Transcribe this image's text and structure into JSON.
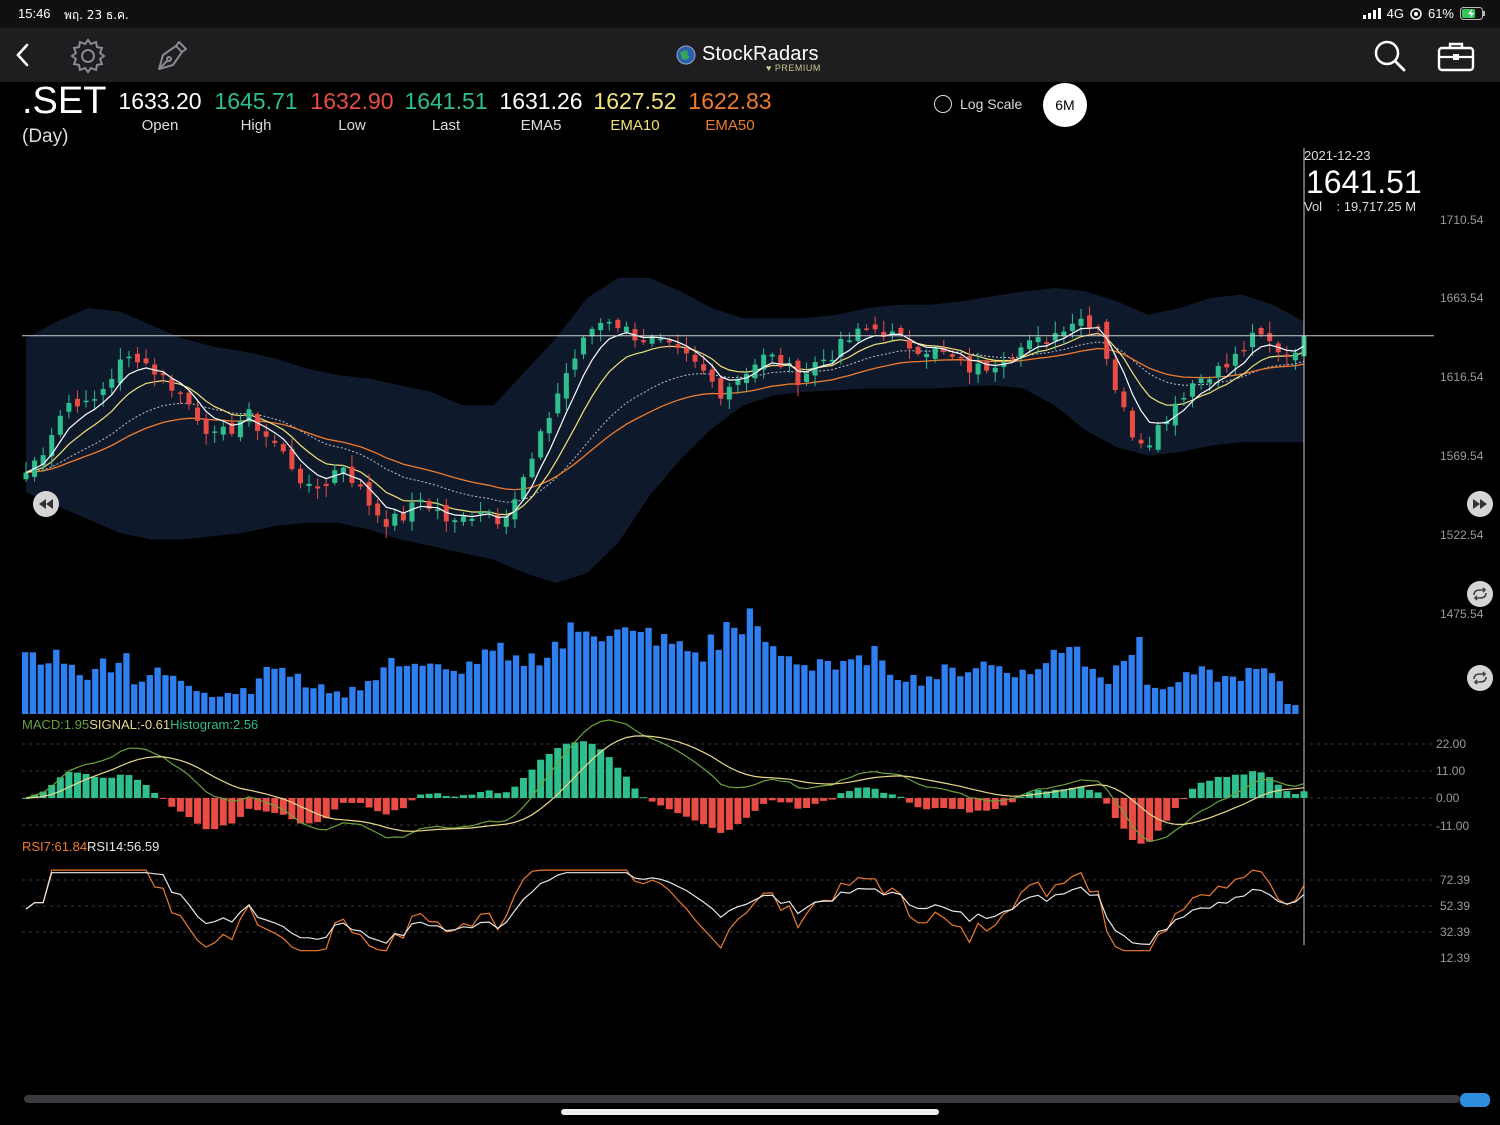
{
  "status_bar": {
    "time": "15:46",
    "date": "พฤ. 23 ธ.ค.",
    "network": "4G",
    "battery": "61%"
  },
  "app": {
    "name": "StockRadars",
    "tier": "PREMIUM"
  },
  "quote": {
    "symbol": ".SET",
    "period": "(Day)",
    "fields": [
      {
        "label": "Open",
        "value": "1633.20",
        "color": "#ffffff",
        "label_color": "#dddddd"
      },
      {
        "label": "High",
        "value": "1645.71",
        "color": "#2fbf8f",
        "label_color": "#dddddd"
      },
      {
        "label": "Low",
        "value": "1632.90",
        "color": "#e84c45",
        "label_color": "#dddddd"
      },
      {
        "label": "Last",
        "value": "1641.51",
        "color": "#2fbf8f",
        "label_color": "#dddddd"
      },
      {
        "label": "EMA5",
        "value": "1631.26",
        "color": "#ffffff",
        "label_color": "#dddddd"
      },
      {
        "label": "EMA10",
        "value": "1627.52",
        "color": "#f3e27a",
        "label_color": "#f3e27a"
      },
      {
        "label": "EMA50",
        "value": "1622.83",
        "color": "#f07b2c",
        "label_color": "#f07b2c"
      }
    ]
  },
  "controls": {
    "log_scale_label": "Log Scale",
    "range_label": "6M"
  },
  "cursor": {
    "date": "2021-12-23",
    "price": "1641.51",
    "volume_label": "Vol",
    "volume_value": ": 19,717.25 M"
  },
  "price_axis": [
    "1710.54",
    "1663.54",
    "1616.54",
    "1569.54",
    "1522.54",
    "1475.54"
  ],
  "macd": {
    "macd_label": "MACD:1.95",
    "signal_label": "SIGNAL:-0.61",
    "hist_label": "Histogram:2.56",
    "axis": [
      "22.00",
      "11.00",
      "0.00",
      "-11.00"
    ]
  },
  "rsi": {
    "rsi7_label": "RSI7:61.84",
    "rsi14_label": "RSI14:56.59",
    "axis": [
      "72.39",
      "52.39",
      "32.39",
      "12.39"
    ]
  },
  "icons": {
    "back": "chevron-left-icon",
    "settings": "gear-icon",
    "draw": "pen-icon",
    "search": "search-icon",
    "portfolio": "briefcase-icon",
    "rewind": "rewind-icon",
    "forward": "fast-forward-icon",
    "sync": "sync-icon"
  },
  "colors": {
    "up": "#2fbf8f",
    "down": "#e84c45",
    "volume": "#2f7ff0",
    "band": "#0e1a2c",
    "ema5": "#ffffff",
    "ema10": "#f3e27a",
    "ema50": "#f07b2c",
    "macd_line": "#6aa33a",
    "signal_line": "#e8d88a",
    "rsi7": "#f07b2c",
    "rsi14": "#e6e6e6"
  },
  "chart_data": {
    "type": "candlestick",
    "ylim": [
      1475.54,
      1710.54
    ],
    "x_last": "2021-12-23",
    "close_path": [
      1560,
      1572,
      1592,
      1605,
      1598,
      1612,
      1625,
      1630,
      1622,
      1614,
      1605,
      1592,
      1580,
      1586,
      1595,
      1584,
      1575,
      1562,
      1548,
      1554,
      1566,
      1552,
      1538,
      1530,
      1534,
      1544,
      1538,
      1528,
      1534,
      1540,
      1532,
      1545,
      1565,
      1590,
      1615,
      1632,
      1648,
      1652,
      1645,
      1640,
      1638,
      1632,
      1627,
      1619,
      1608,
      1616,
      1624,
      1630,
      1624,
      1616,
      1625,
      1630,
      1638,
      1644,
      1646,
      1641,
      1636,
      1634,
      1631,
      1626,
      1621,
      1624,
      1630,
      1634,
      1637,
      1641,
      1650,
      1652,
      1648,
      1612,
      1585,
      1578,
      1590,
      1604,
      1614,
      1620,
      1622,
      1632,
      1642,
      1636,
      1630,
      1641.51
    ],
    "band_upper": [
      1640,
      1650,
      1658,
      1656,
      1648,
      1640,
      1635,
      1632,
      1628,
      1622,
      1618,
      1616,
      1612,
      1608,
      1600,
      1600,
      1620,
      1640,
      1664,
      1676,
      1676,
      1668,
      1658,
      1652,
      1652,
      1652,
      1654,
      1658,
      1660,
      1660,
      1662,
      1665,
      1668,
      1670,
      1668,
      1662,
      1654,
      1658,
      1664,
      1666,
      1660,
      1650
    ],
    "band_lower": [
      1548,
      1540,
      1532,
      1524,
      1520,
      1520,
      1522,
      1524,
      1528,
      1530,
      1530,
      1526,
      1520,
      1516,
      1512,
      1508,
      1500,
      1494,
      1500,
      1518,
      1546,
      1568,
      1586,
      1600,
      1606,
      1608,
      1609,
      1610,
      1610,
      1610,
      1611,
      1612,
      1610,
      1600,
      1585,
      1575,
      1570,
      1572,
      1576,
      1578,
      1578,
      1578
    ],
    "volume_relative": [
      0.55,
      0.5,
      0.6,
      0.45,
      0.4,
      0.52,
      0.58,
      0.35,
      0.4,
      0.38,
      0.3,
      0.25,
      0.2,
      0.22,
      0.25,
      0.4,
      0.48,
      0.35,
      0.3,
      0.25,
      0.2,
      0.28,
      0.32,
      0.48,
      0.55,
      0.5,
      0.45,
      0.4,
      0.48,
      0.55,
      0.6,
      0.5,
      0.55,
      0.6,
      0.7,
      0.8,
      0.9,
      0.85,
      0.8,
      0.75,
      0.8,
      0.7,
      0.65,
      0.6,
      0.7,
      0.85,
      0.95,
      0.75,
      0.6,
      0.55,
      0.5,
      0.55,
      0.45,
      0.5,
      0.6,
      0.45,
      0.4,
      0.35,
      0.38,
      0.42,
      0.45,
      0.5,
      0.48,
      0.45,
      0.4,
      0.5,
      0.6,
      0.75,
      0.5,
      0.35,
      0.6,
      0.65,
      0.3,
      0.25,
      0.35,
      0.4,
      0.38,
      0.35,
      0.4,
      0.42,
      0.35,
      0.1
    ],
    "macd_axis": [
      -11,
      22
    ],
    "rsi_axis": [
      12.39,
      72.39
    ]
  }
}
